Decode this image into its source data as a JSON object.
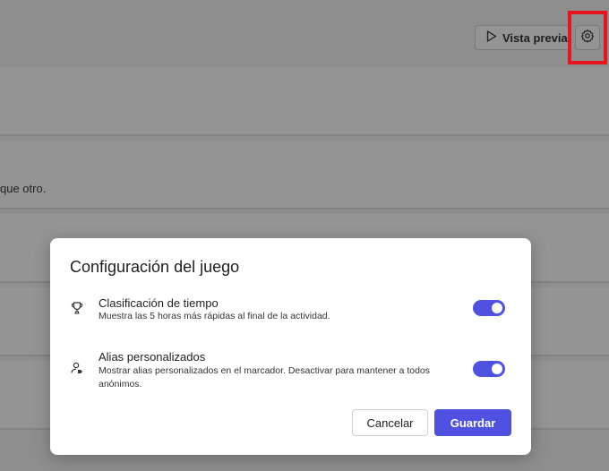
{
  "header": {
    "preview_label": "Vista previa",
    "preview_icon": "play-icon",
    "settings_icon": "gear-icon"
  },
  "background": {
    "snippet": "que otro."
  },
  "dialog": {
    "title": "Configuración del juego",
    "settings": [
      {
        "title": "Clasificación de tiempo",
        "description": "Muestra las 5 horas más rápidas al final de la actividad.",
        "icon": "trophy-icon",
        "enabled": true
      },
      {
        "title": "Alias personalizados",
        "description": "Mostrar alias personalizados en el marcador. Desactivar para mantener a todos anónimos.",
        "icon": "user-tag-icon",
        "enabled": true
      }
    ],
    "cancel_label": "Cancelar",
    "save_label": "Guardar"
  },
  "colors": {
    "accent": "#4f52e0",
    "highlight": "#e8141e"
  }
}
